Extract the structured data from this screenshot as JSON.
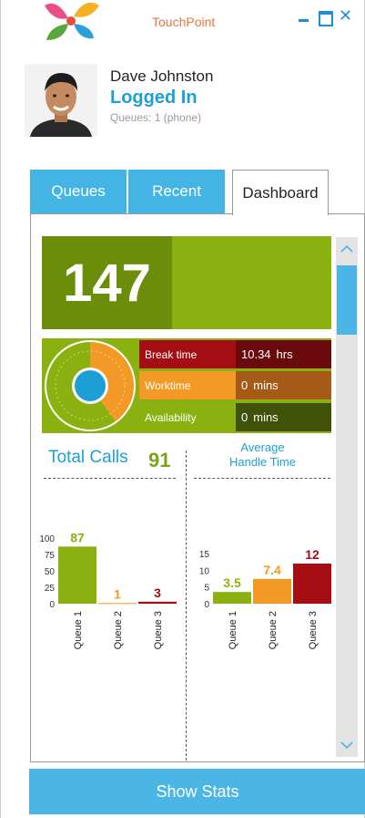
{
  "window": {
    "title": "TouchPoint"
  },
  "profile": {
    "name": "Dave Johnston",
    "status": "Logged In",
    "queues_text": "Queues: 1 (phone)"
  },
  "tabs": [
    {
      "label": "Queues",
      "active": false
    },
    {
      "label": "Recent",
      "active": false
    },
    {
      "label": "Dashboard",
      "active": true
    }
  ],
  "dashboard": {
    "big_number": "147",
    "stats": [
      {
        "label": "Break time",
        "value": "10.34",
        "unit": "hrs"
      },
      {
        "label": "Worktime",
        "value": "0",
        "unit": "mins"
      },
      {
        "label": "Availability",
        "value": "0",
        "unit": "mins"
      }
    ],
    "total_calls_label": "Total Calls",
    "total_calls_value": "91",
    "aht_label_line1": "Average",
    "aht_label_line2": "Handle Time"
  },
  "colors": {
    "accent_blue": "#1d9fd6",
    "green": "#8ab10f",
    "orange": "#f29a25",
    "red": "#a40d12"
  },
  "chart_data": [
    {
      "type": "bar",
      "categories": [
        "Queue 1",
        "Queue 2",
        "Queue 3"
      ],
      "values": [
        87,
        1,
        3
      ],
      "title": "Total Calls",
      "ylim": [
        0,
        100
      ],
      "yticks": [
        0,
        25,
        50,
        75,
        100
      ],
      "colors": [
        "#8ab10f",
        "#f29a25",
        "#a40d12"
      ]
    },
    {
      "type": "bar",
      "categories": [
        "Queue 1",
        "Queue 2",
        "Queue 3"
      ],
      "values": [
        3.5,
        7.4,
        12
      ],
      "title": "Average Handle Time",
      "ylim": [
        0,
        15
      ],
      "yticks": [
        0,
        5,
        10,
        15
      ],
      "colors": [
        "#8ab10f",
        "#f29a25",
        "#a40d12"
      ]
    }
  ],
  "buttons": {
    "show_stats": "Show Stats"
  }
}
